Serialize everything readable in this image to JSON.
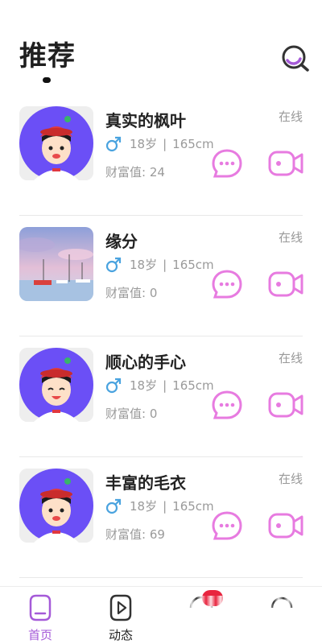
{
  "header": {
    "title": "推荐",
    "search_icon": "search-icon"
  },
  "colors": {
    "accent": "#a55ad8",
    "icon_pink": "#e77be0",
    "male_blue": "#4aa3df",
    "badge_red": "#e8253f",
    "avatar_bg": "#6b4ff6"
  },
  "users": [
    {
      "name": "真实的枫叶",
      "status": "在线",
      "age": "18岁",
      "separator": "|",
      "height": "165cm",
      "wealth_label": "财富值:",
      "wealth_value": "24",
      "avatar": "cartoon-boy"
    },
    {
      "name": "缘分",
      "status": "在线",
      "age": "18岁",
      "separator": "|",
      "height": "165cm",
      "wealth_label": "财富值:",
      "wealth_value": "0",
      "avatar": "harbor-photo"
    },
    {
      "name": "顺心的手心",
      "status": "在线",
      "age": "18岁",
      "separator": "|",
      "height": "165cm",
      "wealth_label": "财富值:",
      "wealth_value": "0",
      "avatar": "cartoon-boy"
    },
    {
      "name": "丰富的毛衣",
      "status": "在线",
      "age": "18岁",
      "separator": "|",
      "height": "165cm",
      "wealth_label": "财富值:",
      "wealth_value": "69",
      "avatar": "cartoon-boy"
    }
  ],
  "tabbar": {
    "tabs": [
      {
        "label": "首页",
        "icon": "home-icon",
        "active": true
      },
      {
        "label": "动态",
        "icon": "play-icon",
        "active": false
      },
      {
        "label": "",
        "icon": "message-icon",
        "active": false
      },
      {
        "label": "",
        "icon": "profile-icon",
        "active": false
      }
    ]
  }
}
